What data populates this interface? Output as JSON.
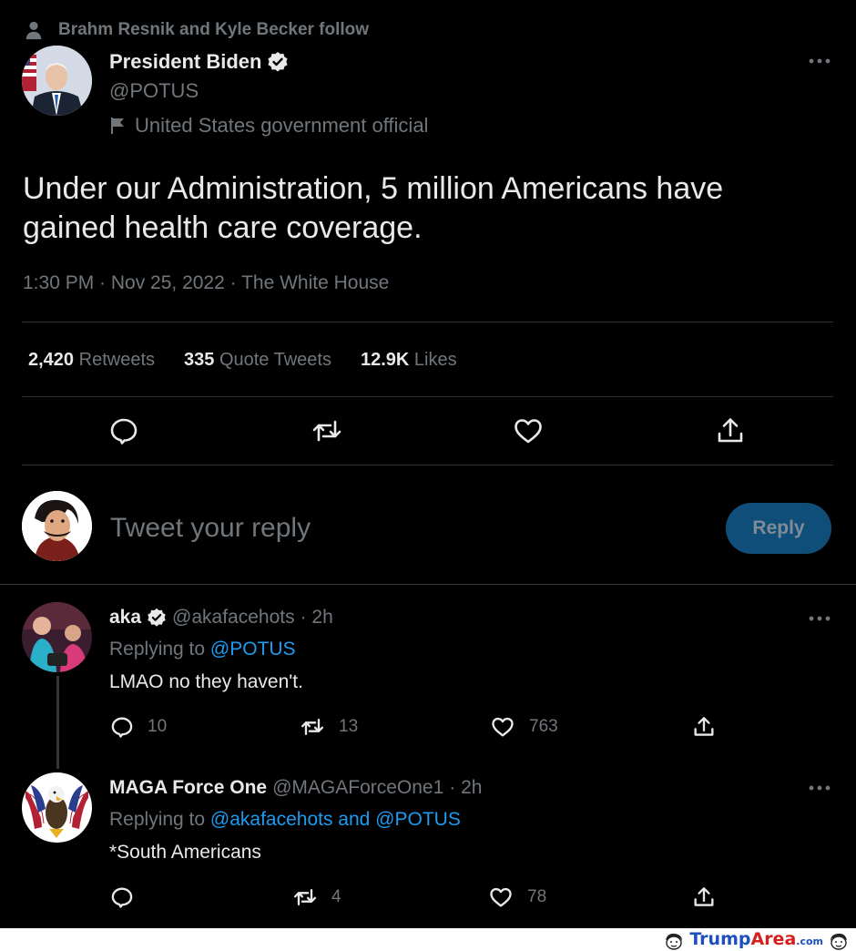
{
  "social_context": "Brahm Resnik and Kyle Becker follow",
  "tweet": {
    "author_name": "President Biden",
    "author_handle": "@POTUS",
    "label": "United States government official",
    "text": "Under our Administration, 5 million Americans have gained health care coverage.",
    "meta": "1:30 PM · Nov 25, 2022 · The White House",
    "stats": {
      "retweets_count": "2,420",
      "retweets_label": "Retweets",
      "quotes_count": "335",
      "quotes_label": "Quote Tweets",
      "likes_count": "12.9K",
      "likes_label": "Likes"
    }
  },
  "composer": {
    "placeholder": "Tweet your reply",
    "button_label": "Reply"
  },
  "replies": [
    {
      "name": "aka",
      "handle": "@akafacehots",
      "time": "· 2h",
      "replying_prefix": "Replying to",
      "replying_to": "@POTUS",
      "text": "LMAO no they haven't.",
      "reply_count": "10",
      "retweet_count": "13",
      "like_count": "763"
    },
    {
      "name": "MAGA Force One",
      "handle": "@MAGAForceOne1",
      "time": "· 2h",
      "replying_prefix": "Replying to",
      "replying_to": "@akafacehots and @POTUS",
      "text": "*South Americans",
      "retweet_count": "4",
      "like_count": "78"
    }
  ],
  "watermark": {
    "part1": "Trump",
    "part2": "Area",
    "part3": ".com"
  },
  "colors": {
    "background": "#000000",
    "text": "#e7e9ea",
    "muted": "#71767b",
    "link": "#1d9bf0",
    "reply_button": "#0f4e78"
  },
  "icons": [
    "person-icon",
    "verified-badge-icon",
    "flag-icon",
    "more-icon",
    "reply-icon",
    "retweet-icon",
    "like-icon",
    "share-icon"
  ]
}
